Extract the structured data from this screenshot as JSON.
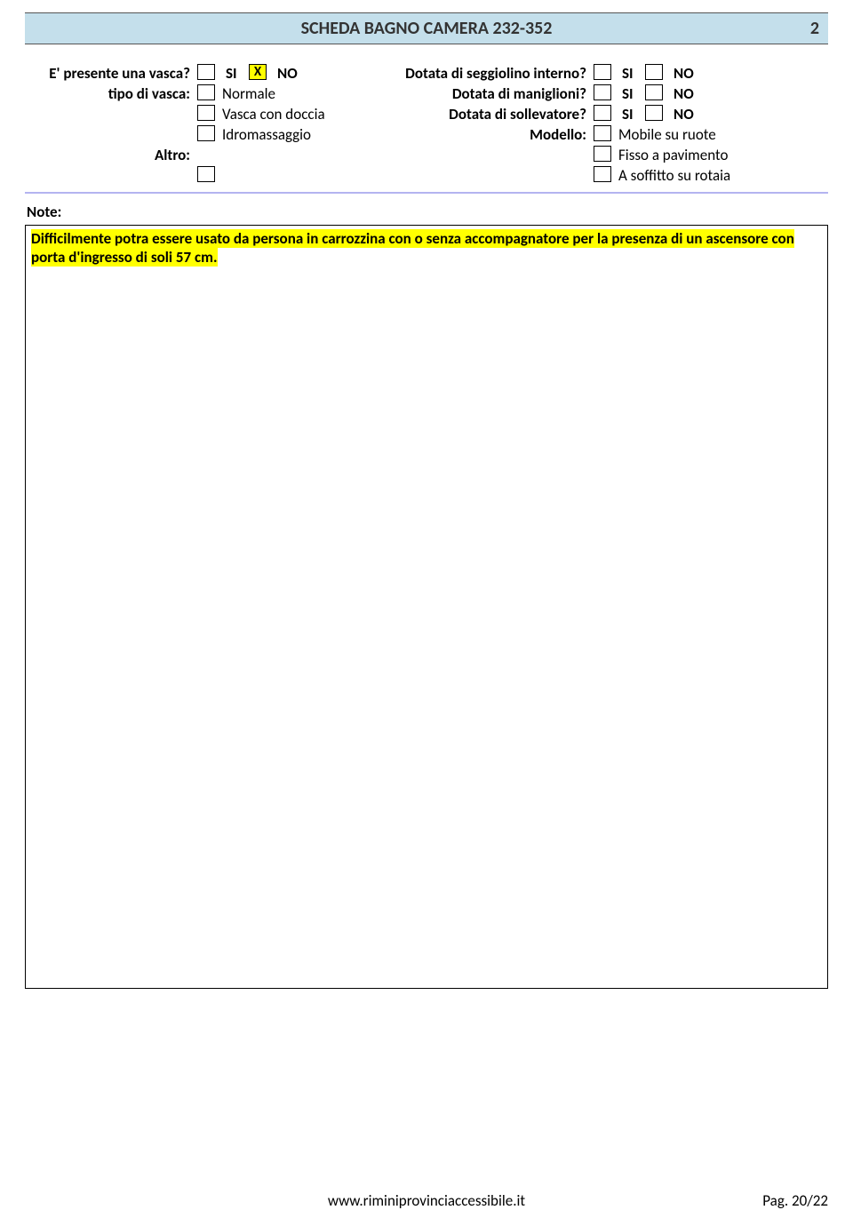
{
  "header": {
    "title": "SCHEDA BAGNO CAMERA 232-352",
    "page_number": "2"
  },
  "left": {
    "q_vasca": "E' presente una vasca?",
    "si": "SI",
    "no": "NO",
    "x": "X",
    "tipo_label": "tipo di vasca:",
    "opt_normale": "Normale",
    "opt_doccia": "Vasca con doccia",
    "opt_idro": "Idromassaggio",
    "altro_label": "Altro:"
  },
  "right": {
    "q_seggiolino": "Dotata di seggiolino interno?",
    "q_maniglioni": "Dotata di maniglioni?",
    "q_sollevatore": "Dotata di sollevatore?",
    "modello_label": "Modello:",
    "opt_mobile": "Mobile su ruote",
    "opt_fisso": "Fisso a pavimento",
    "opt_soffitto": "A soffitto su rotaia",
    "si": "SI",
    "no": "NO"
  },
  "notes": {
    "label": "Note:",
    "text": "Difficilmente potra essere usato da persona in carrozzina con o senza accompagnatore per la presenza di un ascensore con porta d'ingresso di soli 57 cm."
  },
  "footer": {
    "site": "www.riminiprovinciaccessibile.it",
    "pag": "Pag. 20/22"
  }
}
